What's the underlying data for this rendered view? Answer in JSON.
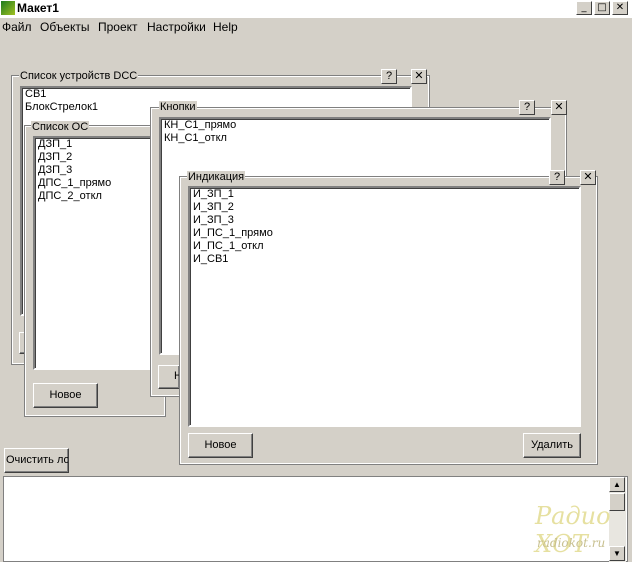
{
  "window": {
    "title": "Макет1",
    "controls": [
      "_",
      "□",
      "✕"
    ]
  },
  "menu": [
    "Файл",
    "Объекты",
    "Проект",
    "Настройки",
    "Help"
  ],
  "dcc_panel": {
    "title": "Список устройств DCC",
    "help": "?",
    "close": "✕",
    "items": [
      "СВ1",
      "БлокСтрелок1"
    ]
  },
  "os_panel": {
    "title": "Список ОС",
    "items": [
      "ДЗП_1",
      "ДЗП_2",
      "ДЗП_3",
      "ДПС_1_прямо",
      "ДПС_2_откл"
    ],
    "new_button": "Новое"
  },
  "buttons_panel": {
    "title": "Кнопки",
    "help": "?",
    "close": "✕",
    "items": [
      "КН_С1_прямо",
      "КН_С1_откл"
    ],
    "partial_button": "Н"
  },
  "indication_panel": {
    "title": "Индикация",
    "help": "?",
    "close": "✕",
    "items": [
      "И_ЗП_1",
      "И_ЗП_2",
      "И_ЗП_3",
      "И_ПС_1_прямо",
      "И_ПС_1_откл",
      "И_СВ1"
    ],
    "new_button": "Новое",
    "delete_button": "Удалить"
  },
  "clear_log_button": "Очистить лог",
  "scrollbar": {
    "up": "▲",
    "down": "▼"
  },
  "watermark": {
    "line1": "Радио  ХОТ",
    "line2": "radiokot.ru"
  }
}
